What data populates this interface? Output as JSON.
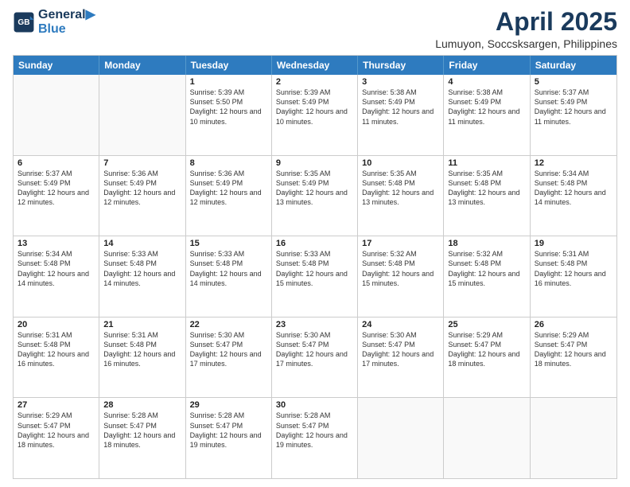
{
  "logo": {
    "line1": "General",
    "line2": "Blue"
  },
  "title": "April 2025",
  "subtitle": "Lumuyon, Soccsksargen, Philippines",
  "header_days": [
    "Sunday",
    "Monday",
    "Tuesday",
    "Wednesday",
    "Thursday",
    "Friday",
    "Saturday"
  ],
  "weeks": [
    [
      {
        "day": "",
        "sunrise": "",
        "sunset": "",
        "daylight": ""
      },
      {
        "day": "",
        "sunrise": "",
        "sunset": "",
        "daylight": ""
      },
      {
        "day": "1",
        "sunrise": "Sunrise: 5:39 AM",
        "sunset": "Sunset: 5:50 PM",
        "daylight": "Daylight: 12 hours and 10 minutes."
      },
      {
        "day": "2",
        "sunrise": "Sunrise: 5:39 AM",
        "sunset": "Sunset: 5:49 PM",
        "daylight": "Daylight: 12 hours and 10 minutes."
      },
      {
        "day": "3",
        "sunrise": "Sunrise: 5:38 AM",
        "sunset": "Sunset: 5:49 PM",
        "daylight": "Daylight: 12 hours and 11 minutes."
      },
      {
        "day": "4",
        "sunrise": "Sunrise: 5:38 AM",
        "sunset": "Sunset: 5:49 PM",
        "daylight": "Daylight: 12 hours and 11 minutes."
      },
      {
        "day": "5",
        "sunrise": "Sunrise: 5:37 AM",
        "sunset": "Sunset: 5:49 PM",
        "daylight": "Daylight: 12 hours and 11 minutes."
      }
    ],
    [
      {
        "day": "6",
        "sunrise": "Sunrise: 5:37 AM",
        "sunset": "Sunset: 5:49 PM",
        "daylight": "Daylight: 12 hours and 12 minutes."
      },
      {
        "day": "7",
        "sunrise": "Sunrise: 5:36 AM",
        "sunset": "Sunset: 5:49 PM",
        "daylight": "Daylight: 12 hours and 12 minutes."
      },
      {
        "day": "8",
        "sunrise": "Sunrise: 5:36 AM",
        "sunset": "Sunset: 5:49 PM",
        "daylight": "Daylight: 12 hours and 12 minutes."
      },
      {
        "day": "9",
        "sunrise": "Sunrise: 5:35 AM",
        "sunset": "Sunset: 5:49 PM",
        "daylight": "Daylight: 12 hours and 13 minutes."
      },
      {
        "day": "10",
        "sunrise": "Sunrise: 5:35 AM",
        "sunset": "Sunset: 5:48 PM",
        "daylight": "Daylight: 12 hours and 13 minutes."
      },
      {
        "day": "11",
        "sunrise": "Sunrise: 5:35 AM",
        "sunset": "Sunset: 5:48 PM",
        "daylight": "Daylight: 12 hours and 13 minutes."
      },
      {
        "day": "12",
        "sunrise": "Sunrise: 5:34 AM",
        "sunset": "Sunset: 5:48 PM",
        "daylight": "Daylight: 12 hours and 14 minutes."
      }
    ],
    [
      {
        "day": "13",
        "sunrise": "Sunrise: 5:34 AM",
        "sunset": "Sunset: 5:48 PM",
        "daylight": "Daylight: 12 hours and 14 minutes."
      },
      {
        "day": "14",
        "sunrise": "Sunrise: 5:33 AM",
        "sunset": "Sunset: 5:48 PM",
        "daylight": "Daylight: 12 hours and 14 minutes."
      },
      {
        "day": "15",
        "sunrise": "Sunrise: 5:33 AM",
        "sunset": "Sunset: 5:48 PM",
        "daylight": "Daylight: 12 hours and 14 minutes."
      },
      {
        "day": "16",
        "sunrise": "Sunrise: 5:33 AM",
        "sunset": "Sunset: 5:48 PM",
        "daylight": "Daylight: 12 hours and 15 minutes."
      },
      {
        "day": "17",
        "sunrise": "Sunrise: 5:32 AM",
        "sunset": "Sunset: 5:48 PM",
        "daylight": "Daylight: 12 hours and 15 minutes."
      },
      {
        "day": "18",
        "sunrise": "Sunrise: 5:32 AM",
        "sunset": "Sunset: 5:48 PM",
        "daylight": "Daylight: 12 hours and 15 minutes."
      },
      {
        "day": "19",
        "sunrise": "Sunrise: 5:31 AM",
        "sunset": "Sunset: 5:48 PM",
        "daylight": "Daylight: 12 hours and 16 minutes."
      }
    ],
    [
      {
        "day": "20",
        "sunrise": "Sunrise: 5:31 AM",
        "sunset": "Sunset: 5:48 PM",
        "daylight": "Daylight: 12 hours and 16 minutes."
      },
      {
        "day": "21",
        "sunrise": "Sunrise: 5:31 AM",
        "sunset": "Sunset: 5:48 PM",
        "daylight": "Daylight: 12 hours and 16 minutes."
      },
      {
        "day": "22",
        "sunrise": "Sunrise: 5:30 AM",
        "sunset": "Sunset: 5:47 PM",
        "daylight": "Daylight: 12 hours and 17 minutes."
      },
      {
        "day": "23",
        "sunrise": "Sunrise: 5:30 AM",
        "sunset": "Sunset: 5:47 PM",
        "daylight": "Daylight: 12 hours and 17 minutes."
      },
      {
        "day": "24",
        "sunrise": "Sunrise: 5:30 AM",
        "sunset": "Sunset: 5:47 PM",
        "daylight": "Daylight: 12 hours and 17 minutes."
      },
      {
        "day": "25",
        "sunrise": "Sunrise: 5:29 AM",
        "sunset": "Sunset: 5:47 PM",
        "daylight": "Daylight: 12 hours and 18 minutes."
      },
      {
        "day": "26",
        "sunrise": "Sunrise: 5:29 AM",
        "sunset": "Sunset: 5:47 PM",
        "daylight": "Daylight: 12 hours and 18 minutes."
      }
    ],
    [
      {
        "day": "27",
        "sunrise": "Sunrise: 5:29 AM",
        "sunset": "Sunset: 5:47 PM",
        "daylight": "Daylight: 12 hours and 18 minutes."
      },
      {
        "day": "28",
        "sunrise": "Sunrise: 5:28 AM",
        "sunset": "Sunset: 5:47 PM",
        "daylight": "Daylight: 12 hours and 18 minutes."
      },
      {
        "day": "29",
        "sunrise": "Sunrise: 5:28 AM",
        "sunset": "Sunset: 5:47 PM",
        "daylight": "Daylight: 12 hours and 19 minutes."
      },
      {
        "day": "30",
        "sunrise": "Sunrise: 5:28 AM",
        "sunset": "Sunset: 5:47 PM",
        "daylight": "Daylight: 12 hours and 19 minutes."
      },
      {
        "day": "",
        "sunrise": "",
        "sunset": "",
        "daylight": ""
      },
      {
        "day": "",
        "sunrise": "",
        "sunset": "",
        "daylight": ""
      },
      {
        "day": "",
        "sunrise": "",
        "sunset": "",
        "daylight": ""
      }
    ]
  ]
}
